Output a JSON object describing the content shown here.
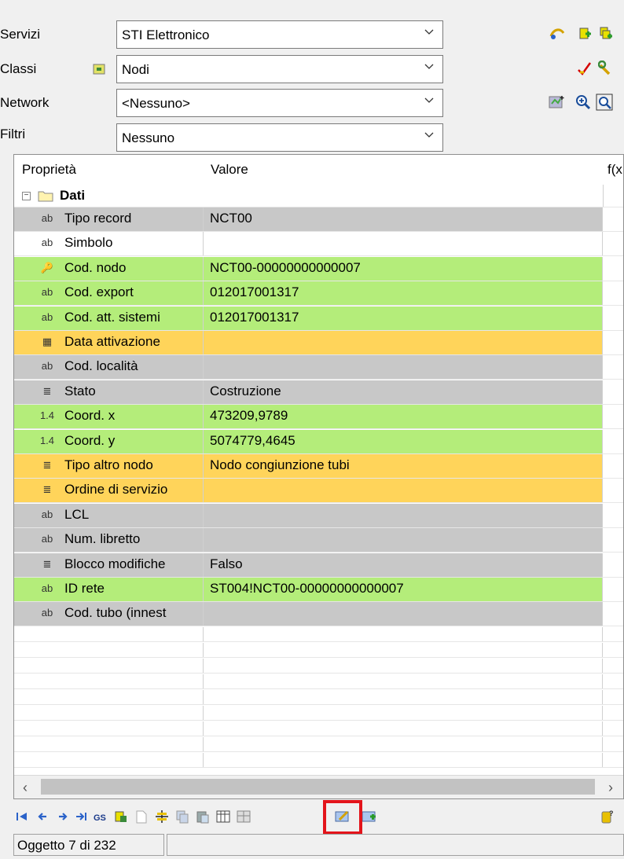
{
  "filters": {
    "servizi": {
      "label": "Servizi",
      "value": "STI Elettronico"
    },
    "classi": {
      "label": "Classi",
      "value": "Nodi"
    },
    "network": {
      "label": "Network",
      "value": "<Nessuno>"
    },
    "filtri": {
      "label": "Filtri",
      "value": "Nessuno"
    }
  },
  "grid": {
    "headers": {
      "property": "Proprietà",
      "value": "Valore",
      "formula": "f(x"
    },
    "group": {
      "label": "Dati",
      "expander": "−"
    },
    "rows": [
      {
        "icon": "ab",
        "label": "Tipo record",
        "value": "NCT00",
        "color": "gray"
      },
      {
        "icon": "ab",
        "label": "Simbolo",
        "value": "",
        "color": "white"
      },
      {
        "icon": "🔑",
        "label": "Cod. nodo",
        "value": "NCT00-00000000000007",
        "color": "green"
      },
      {
        "icon": "ab",
        "label": "Cod. export",
        "value": "012017001317",
        "color": "green"
      },
      {
        "icon": "ab",
        "label": "Cod. att. sistemi",
        "value": "012017001317",
        "color": "green"
      },
      {
        "icon": "▦",
        "label": "Data attivazione",
        "value": "",
        "color": "orange"
      },
      {
        "icon": "ab",
        "label": "Cod. località",
        "value": "",
        "color": "gray"
      },
      {
        "icon": "≣",
        "label": "Stato",
        "value": "Costruzione",
        "color": "gray"
      },
      {
        "icon": "1.4",
        "label": "Coord. x",
        "value": "473209,9789",
        "color": "green"
      },
      {
        "icon": "1.4",
        "label": "Coord. y",
        "value": "5074779,4645",
        "color": "green"
      },
      {
        "icon": "≣",
        "label": "Tipo altro nodo",
        "value": "Nodo congiunzione tubi",
        "color": "orange"
      },
      {
        "icon": "≣",
        "label": "Ordine di servizio",
        "value": "",
        "color": "orange"
      },
      {
        "icon": "ab",
        "label": "LCL",
        "value": "",
        "color": "gray"
      },
      {
        "icon": "ab",
        "label": "Num. libretto",
        "value": "",
        "color": "gray"
      },
      {
        "icon": "≣",
        "label": "Blocco modifiche",
        "value": "Falso",
        "color": "gray"
      },
      {
        "icon": "ab",
        "label": "ID rete",
        "value": "ST004!NCT00-00000000000007",
        "color": "green"
      },
      {
        "icon": "ab",
        "label": "Cod. tubo (innest​",
        "value": "",
        "color": "gray"
      }
    ]
  },
  "colors": {
    "gray": "#c8c8c8",
    "green": "#b4ed7a",
    "orange": "#ffd45a",
    "highlight": "#e3141b"
  },
  "toolbar_icons": [
    "first-record-icon",
    "prev-record-icon",
    "next-record-icon",
    "last-record-icon",
    "gs-icon",
    "attach-icon",
    "new-icon",
    "align-icon",
    "copy-icon",
    "paste-icon",
    "table-icon",
    "grid-icon",
    "edit-icon",
    "save-icon"
  ],
  "status": {
    "text": "Oggetto 7 di 232"
  }
}
